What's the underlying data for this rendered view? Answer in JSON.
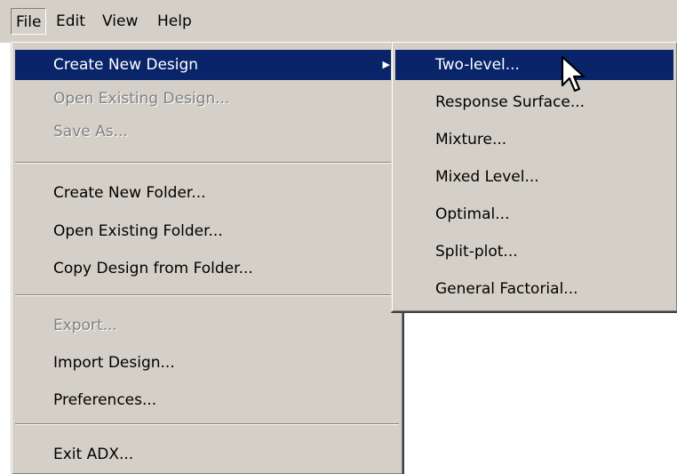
{
  "menubar": {
    "items": [
      {
        "label": "File"
      },
      {
        "label": "Edit"
      },
      {
        "label": "View"
      },
      {
        "label": "Help"
      }
    ]
  },
  "file_menu": {
    "items": [
      {
        "label": "Create New Design",
        "state": "highlighted",
        "has_submenu": true
      },
      {
        "label": "Open Existing Design...",
        "state": "disabled"
      },
      {
        "label": "Save As...",
        "state": "disabled"
      },
      {
        "label": "Create New Folder...",
        "state": "enabled"
      },
      {
        "label": "Open Existing Folder...",
        "state": "enabled"
      },
      {
        "label": "Copy Design from Folder...",
        "state": "enabled"
      },
      {
        "label": "Export...",
        "state": "disabled"
      },
      {
        "label": "Import Design...",
        "state": "enabled"
      },
      {
        "label": "Preferences...",
        "state": "enabled"
      },
      {
        "label": "Exit ADX...",
        "state": "enabled"
      }
    ]
  },
  "submenu": {
    "items": [
      {
        "label": "Two-level...",
        "state": "highlighted"
      },
      {
        "label": "Response Surface...",
        "state": "enabled"
      },
      {
        "label": "Mixture...",
        "state": "enabled"
      },
      {
        "label": "Mixed Level...",
        "state": "enabled"
      },
      {
        "label": "Optimal...",
        "state": "enabled"
      },
      {
        "label": "Split-plot...",
        "state": "enabled"
      },
      {
        "label": "General Factorial...",
        "state": "enabled"
      }
    ]
  },
  "icons": {
    "submenu_arrow": "triangle-right-icon",
    "cursor": "arrow-pointer-cursor-icon"
  },
  "colors": {
    "menu_bg": "#d4d0c8",
    "highlight_bg": "#0a246a",
    "highlight_text": "#ffffff",
    "disabled_text": "#808080"
  }
}
